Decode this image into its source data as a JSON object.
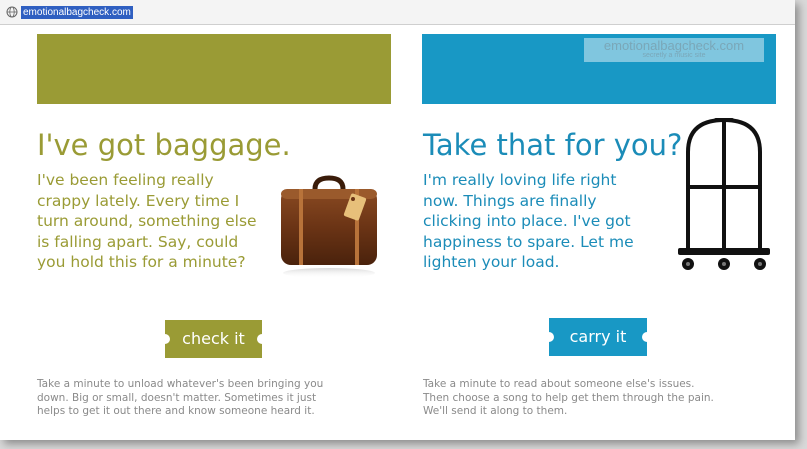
{
  "browser": {
    "url": "emotionalbagcheck.com"
  },
  "brand": {
    "name": "emotionalbagcheck.com",
    "tagline": "secretly a music site"
  },
  "left_panel": {
    "heading": "I've got baggage.",
    "body_lines": [
      "I've been feeling really",
      "crappy lately. Every time I",
      "turn around, something else",
      "is falling apart. Say, could",
      "you hold this for a minute?"
    ],
    "button_label": "check it",
    "caption_lines": [
      "Take a minute to unload whatever's been bringing you",
      "down. Big or small, doesn't matter. Sometimes it just",
      "helps to get it out there and know someone heard it."
    ],
    "color": "#9a9b35",
    "icon": "suitcase-icon"
  },
  "right_panel": {
    "heading": "Take that for you?",
    "body_lines": [
      "I'm really loving life right",
      "now. Things are finally",
      "clicking into place. I've got",
      "happiness to spare. Let me",
      "lighten your load."
    ],
    "button_label": "carry it",
    "caption_lines": [
      "Take a minute to read about someone else's issues.",
      "Then choose a song to help get them through the pain.",
      "We'll send it along to them."
    ],
    "color": "#1898c5",
    "icon": "luggage-cart-icon"
  }
}
